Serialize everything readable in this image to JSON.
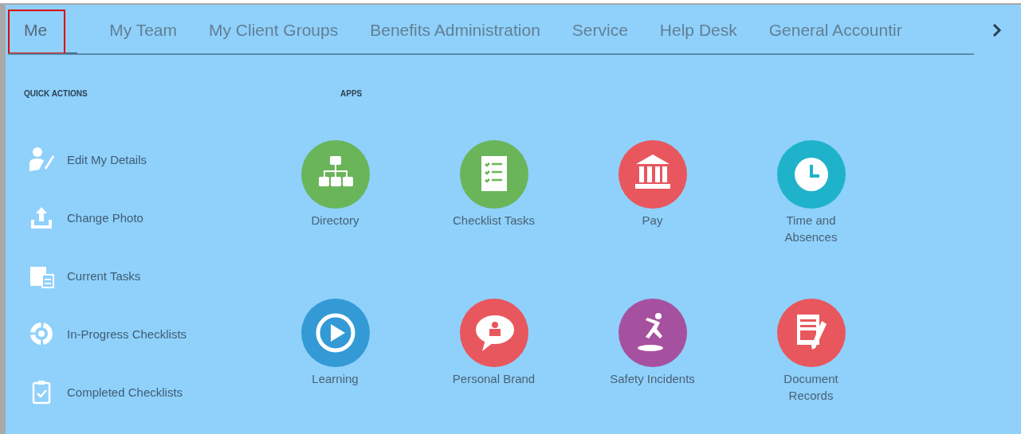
{
  "tabs": [
    {
      "label": "Me",
      "selected": true,
      "highlighted": true
    },
    {
      "label": "My Team",
      "selected": false,
      "highlighted": false
    },
    {
      "label": "My Client Groups",
      "selected": false,
      "highlighted": false
    },
    {
      "label": "Benefits Administration",
      "selected": false,
      "highlighted": false
    },
    {
      "label": "Service",
      "selected": false,
      "highlighted": false
    },
    {
      "label": "Help Desk",
      "selected": false,
      "highlighted": false
    },
    {
      "label": "General Accountir",
      "selected": false,
      "highlighted": false
    }
  ],
  "quick_actions": {
    "title": "QUICK ACTIONS",
    "items": [
      {
        "label": "Edit My Details",
        "kind": "person-edit"
      },
      {
        "label": "Change Photo",
        "kind": "upload"
      },
      {
        "label": "Current Tasks",
        "kind": "calendar"
      },
      {
        "label": "In-Progress Checklists",
        "kind": "progress"
      },
      {
        "label": "Completed Checklists",
        "kind": "clipboard"
      }
    ]
  },
  "apps": {
    "title": "APPS",
    "items": [
      {
        "label": "Directory",
        "kind": "org",
        "color": "#6ab55a"
      },
      {
        "label": "Checklist Tasks",
        "kind": "checklist",
        "color": "#6ab55a"
      },
      {
        "label": "Pay",
        "kind": "bank",
        "color": "#e8575e"
      },
      {
        "label": "Time and Absences",
        "kind": "clock",
        "color": "#1fb3cb"
      },
      {
        "label": "Learning",
        "kind": "play",
        "color": "#339ad6"
      },
      {
        "label": "Personal Brand",
        "kind": "speech",
        "color": "#e8575e"
      },
      {
        "label": "Safety Incidents",
        "kind": "fall",
        "color": "#a6519f"
      },
      {
        "label": "Document Records",
        "kind": "document",
        "color": "#e8575e"
      }
    ]
  }
}
